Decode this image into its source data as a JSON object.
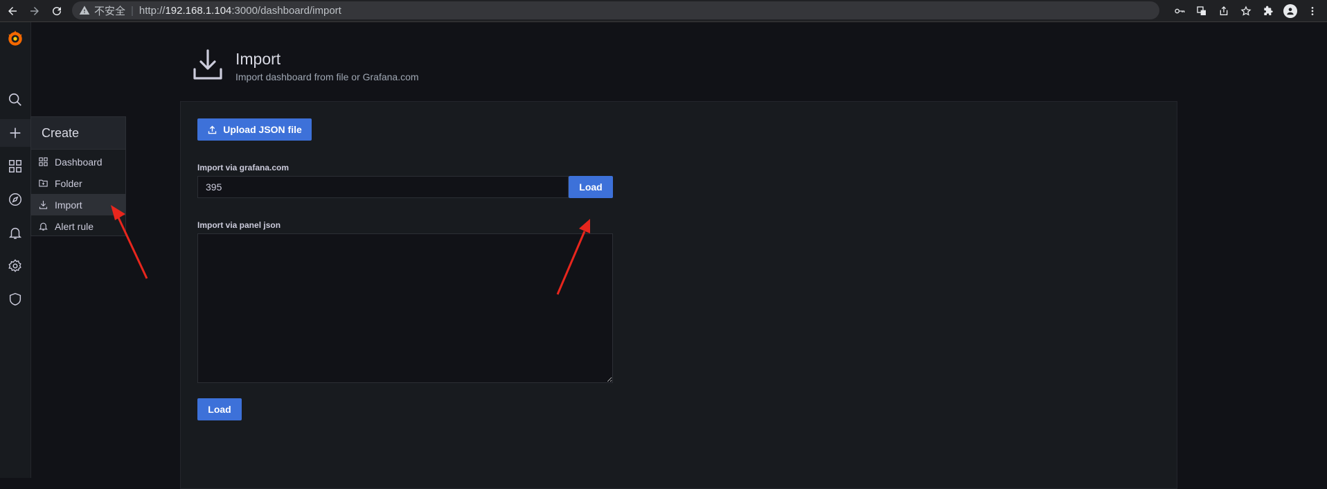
{
  "browser": {
    "insecure_label": "不安全",
    "url_prefix": "http://",
    "url_host": "192.168.1.104",
    "url_rest": ":3000/dashboard/import",
    "icons": [
      "back-icon",
      "forward-icon",
      "reload-icon",
      "warning-icon",
      "key-icon",
      "translate-icon",
      "share-icon",
      "star-icon",
      "extensions-icon",
      "profile-icon",
      "menu-icon"
    ]
  },
  "sidebar": {
    "icons": [
      "grafana-logo-icon",
      "search-icon",
      "plus-icon",
      "dashboards-icon",
      "explore-compass-icon",
      "bell-icon",
      "gear-icon",
      "shield-icon"
    ]
  },
  "create_menu": {
    "title": "Create",
    "items": [
      {
        "label": "Dashboard",
        "icon": "dashboard-grid-icon"
      },
      {
        "label": "Folder",
        "icon": "folder-icon"
      },
      {
        "label": "Import",
        "icon": "import-icon"
      },
      {
        "label": "Alert rule",
        "icon": "bell-icon"
      }
    ]
  },
  "page": {
    "title": "Import",
    "subtitle": "Import dashboard from file or Grafana.com",
    "icon": "import-icon"
  },
  "form": {
    "upload_label": "Upload JSON file",
    "grafana_com_label": "Import via grafana.com",
    "grafana_com_value": "395",
    "load_label": "Load",
    "panel_json_label": "Import via panel json",
    "panel_json_value": "",
    "load_bottom_label": "Load"
  },
  "colors": {
    "accent": "#3d71d9",
    "background": "#111217",
    "panel": "#181b1f",
    "annotation_arrow": "#e8261d",
    "grafana_orange": "#f46800"
  }
}
